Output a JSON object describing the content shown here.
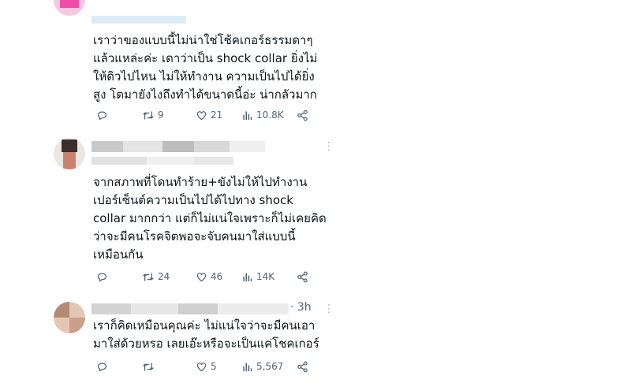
{
  "posts": [
    {
      "time": "",
      "text": "เราว่าของแบบนี้ไม่น่าใช่โช้คเกอร์ธรรมดาๆ\nแล้วแหล่ะค่ะ เดาว่าเป็น shock collar ยิ่งไม่\nให้ดิวไปไหน ไม่ให้ทำงาน ความเป็นไปได้ยิ่ง\nสูง โตมายังไงถึงทำได้ขนาดนี้อ่ะ น่ากลัวมาก",
      "replies": "",
      "retweets": "9",
      "likes": "21",
      "views": "10.8K"
    },
    {
      "time": "",
      "text": "จากสภาพที่โดนทำร้าย+ขังไม่ให้ไปทำงาน\nเปอร์เซ็นต์ความเป็นไปได้ไปทาง shock\ncollar มากกว่า แต่ก็ไม่แน่ใจเพราะก็ไม่เคยคิด\nว่าจะมีคนโรคจิตพอจะจับคนมาใส่แบบนี้\nเหมือนกัน",
      "replies": "",
      "retweets": "24",
      "likes": "46",
      "views": "14K"
    },
    {
      "time": "· 3h",
      "text": "เราก็คิดเหมือนคุณค่ะ ไม่แน่ใจว่าจะมีคนเอา\nมาใส่ด้วยหรอ เลยเอ๊ะหรือจะเป็นแค่โชคเกอร์",
      "replies": "",
      "retweets": "",
      "likes": "5",
      "views": "5,567"
    }
  ],
  "icons": {
    "reply": "reply-icon",
    "retweet": "retweet-icon",
    "like": "heart-icon",
    "views": "views-icon",
    "share": "share-icon",
    "more": "more-icon"
  },
  "colors": {
    "text": "#0f1419",
    "muted": "#536471",
    "blur_gray": "#d9d9d9",
    "blur_blue": "#dcecf7",
    "avatar_pink": "#f04ca8"
  }
}
